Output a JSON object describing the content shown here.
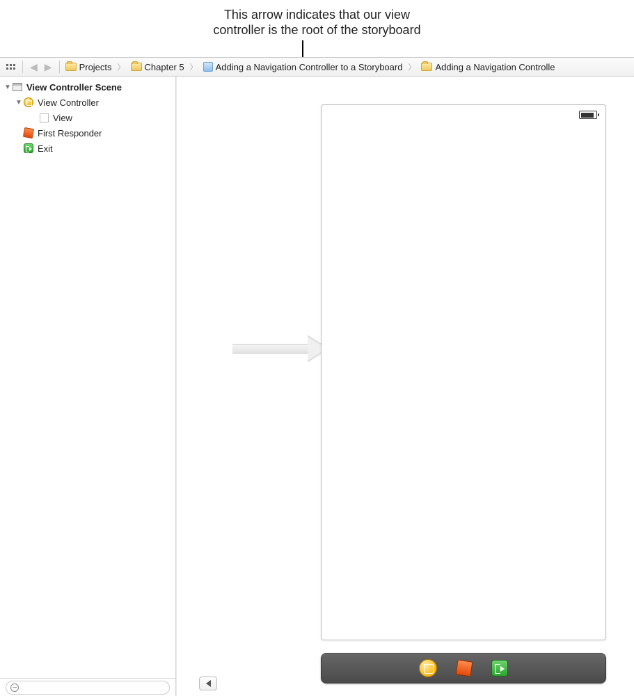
{
  "caption": {
    "line1": "This arrow indicates that our view",
    "line2": "controller is the root of the storyboard"
  },
  "breadcrumbs": {
    "b0": "Projects",
    "b1": "Chapter 5",
    "b2": "Adding a Navigation Controller to a Storyboard",
    "b3": "Adding a Navigation Controlle"
  },
  "outline": {
    "scene": "View Controller Scene",
    "viewController": "View Controller",
    "view": "View",
    "firstResponder": "First Responder",
    "exit": "Exit"
  }
}
